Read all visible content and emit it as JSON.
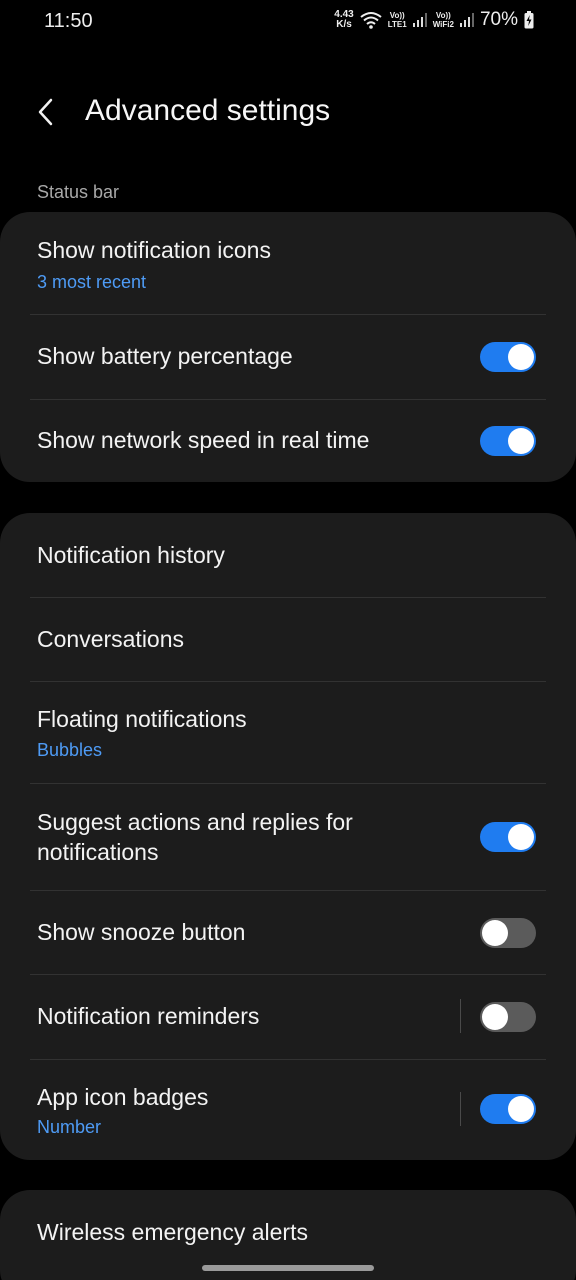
{
  "status_bar": {
    "time": "11:50",
    "net_speed_value": "4.43",
    "net_speed_unit": "K/s",
    "sim1_top": "Vo))",
    "sim1_bottom": "LTE1",
    "sim2_top": "Vo))",
    "sim2_bottom": "WiFi2",
    "battery": "70%"
  },
  "header": {
    "title": "Advanced settings",
    "back_icon": "chevron-left-icon"
  },
  "status_bar_section": {
    "label": "Status bar",
    "items": [
      {
        "title": "Show notification icons",
        "subtitle": "3 most recent"
      },
      {
        "title": "Show battery percentage",
        "toggle": true
      },
      {
        "title": "Show network speed in real time",
        "toggle": true
      }
    ]
  },
  "notifications_section": {
    "items": [
      {
        "title": "Notification history"
      },
      {
        "title": "Conversations"
      },
      {
        "title": "Floating notifications",
        "subtitle": "Bubbles"
      },
      {
        "title_line1": "Suggest actions and replies for",
        "title_line2": "notifications",
        "toggle": true
      },
      {
        "title": "Show snooze button",
        "toggle": false
      },
      {
        "title": "Notification reminders",
        "toggle": false
      },
      {
        "title": "App icon badges",
        "subtitle": "Number",
        "toggle": true
      }
    ]
  },
  "alerts_section": {
    "items": [
      {
        "title": "Wireless emergency alerts"
      }
    ]
  },
  "colors": {
    "accent": "#1f7cf0",
    "subtitle": "#4e9bf5",
    "card_bg": "#1c1c1c",
    "background": "#000000"
  }
}
